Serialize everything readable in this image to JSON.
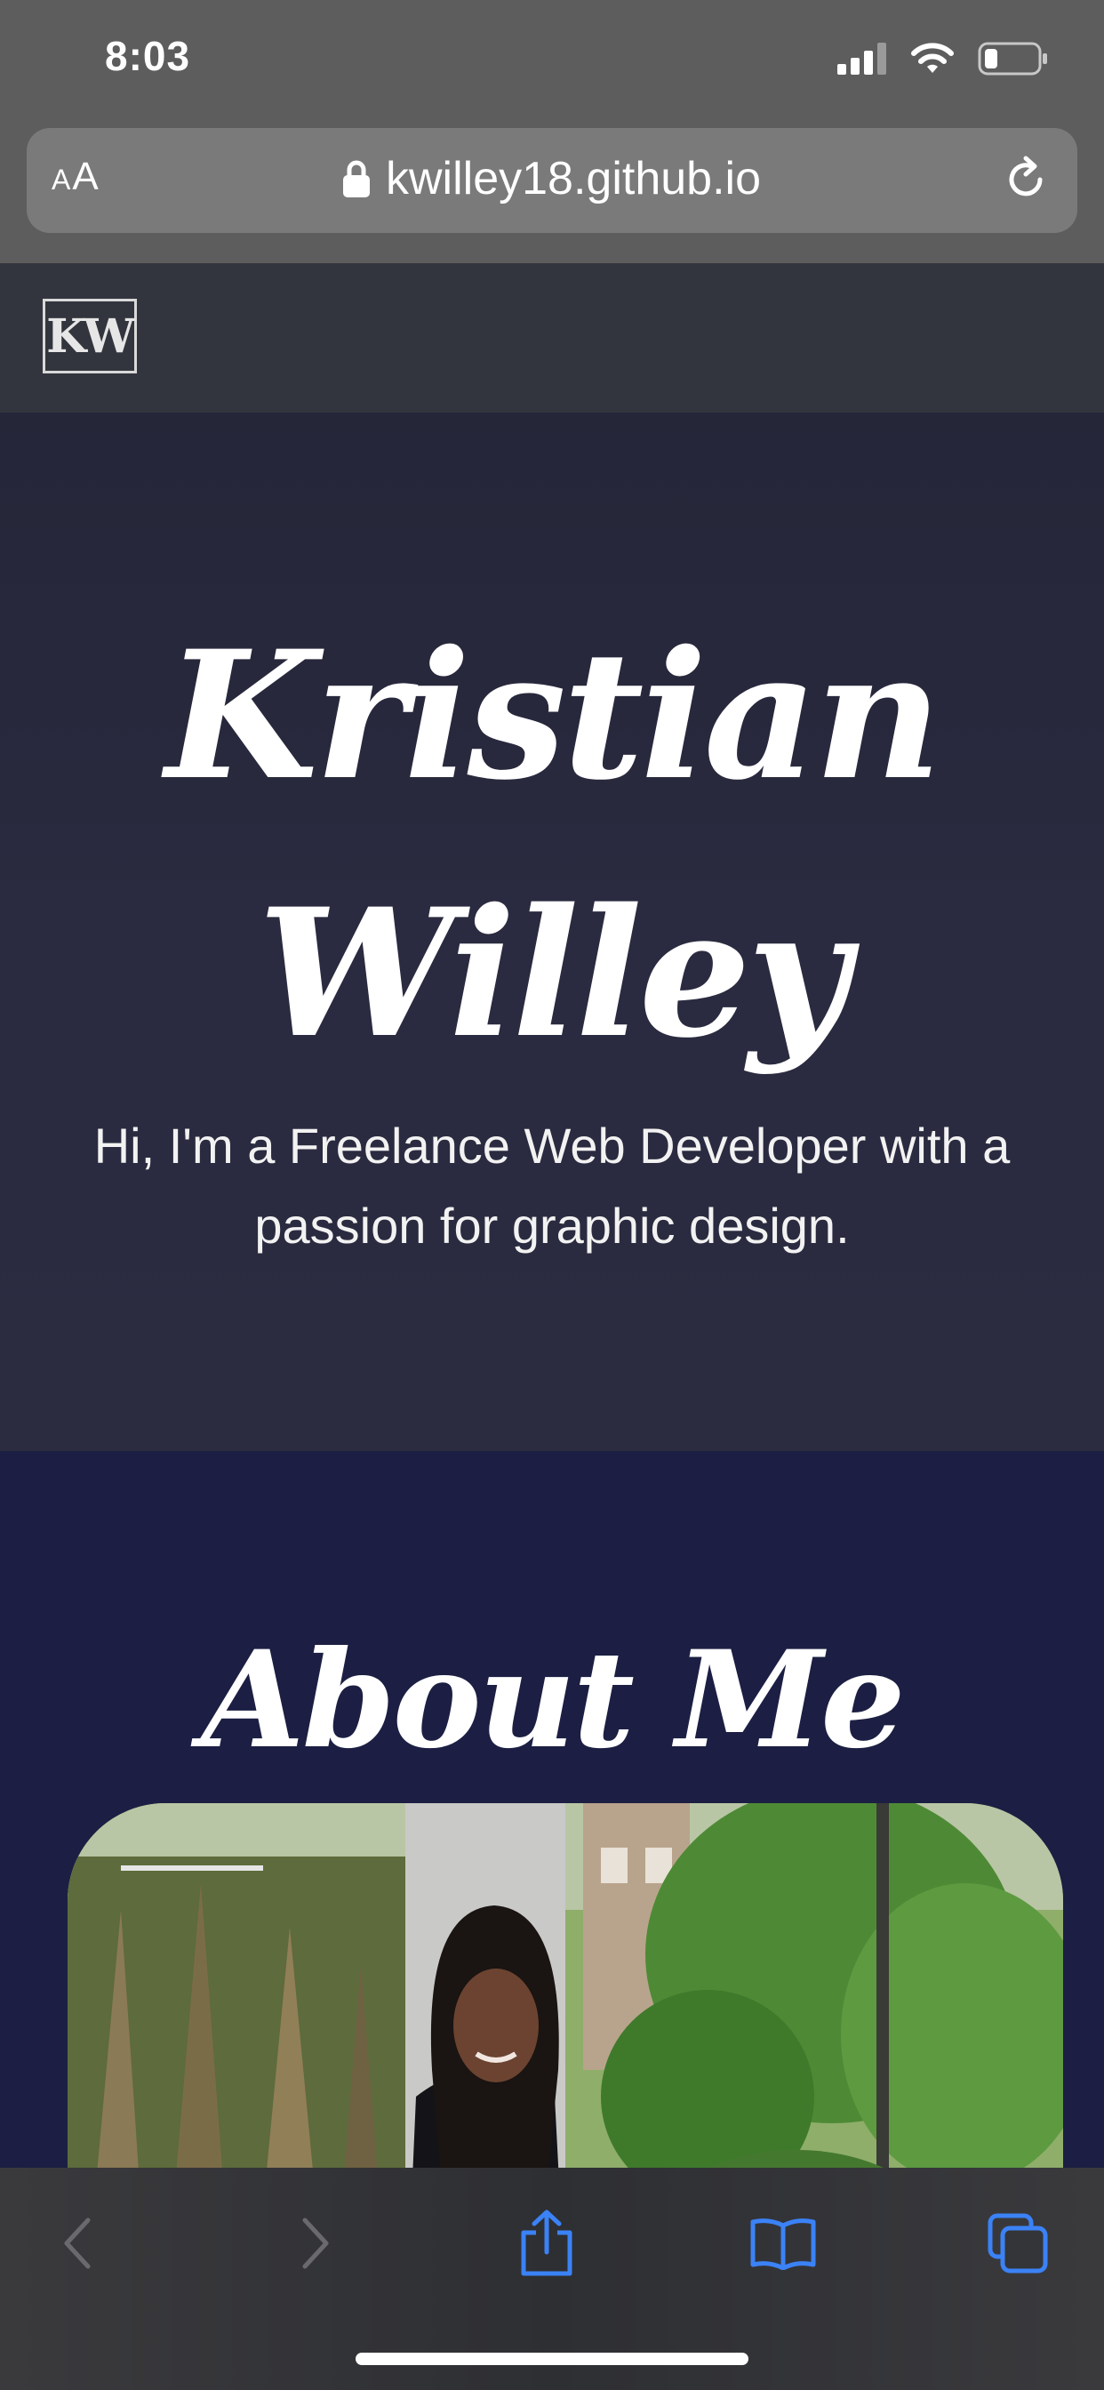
{
  "status_bar": {
    "time": "8:03",
    "icons": [
      "signal-icon",
      "wifi-icon",
      "battery-icon"
    ]
  },
  "browser": {
    "reader_button_label_small": "A",
    "reader_button_label_large": "A",
    "url": "kwilley18.github.io",
    "icons": [
      "lock-icon",
      "reload-icon"
    ]
  },
  "site_nav": {
    "logo_text": "KW"
  },
  "hero": {
    "name_line_1": "Kristian",
    "name_line_2": "Willey",
    "tagline": "Hi, I'm a Freelance Web Developer with a passion for graphic design."
  },
  "about": {
    "title": "About Me"
  },
  "toolbar": {
    "icons": [
      "back-icon",
      "forward-icon",
      "share-icon",
      "bookmarks-icon",
      "tabs-icon"
    ]
  },
  "colors": {
    "chrome_gray": "#5d5d5d",
    "nav_background": "#33353e",
    "hero_background": "#2a2a40",
    "about_background": "#1c1f43",
    "ios_blue": "#3b82f6"
  }
}
